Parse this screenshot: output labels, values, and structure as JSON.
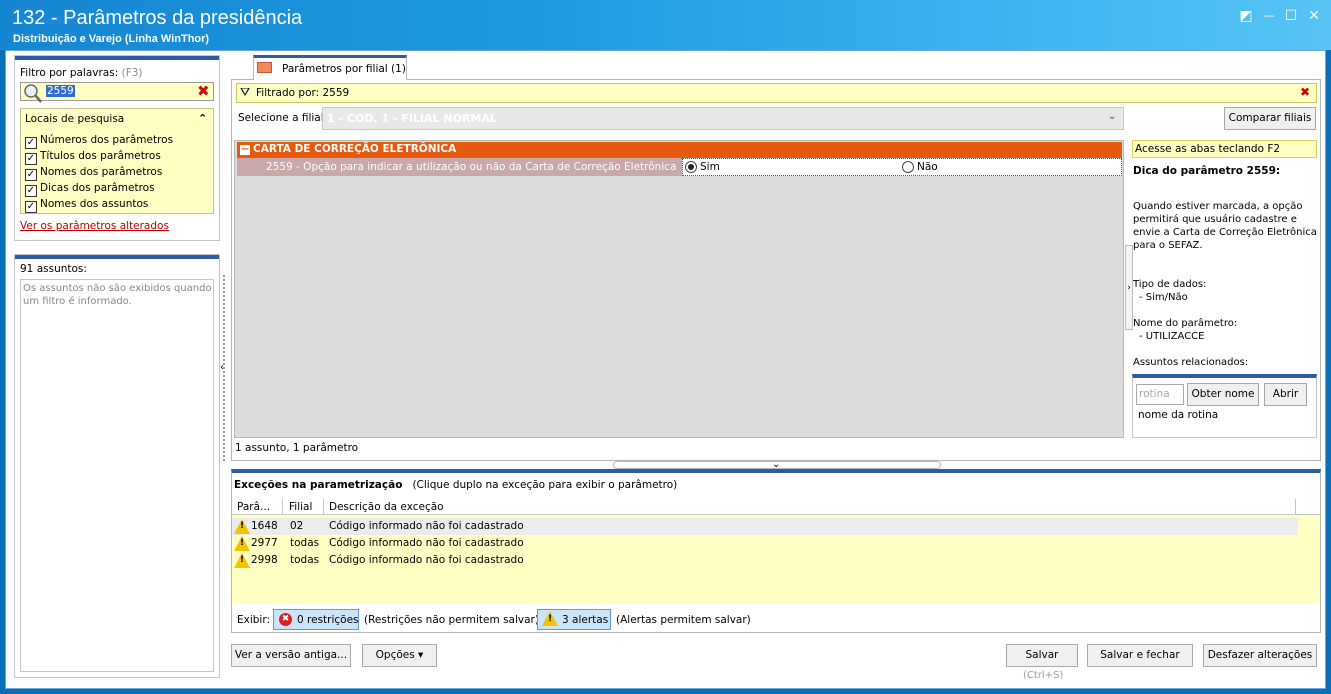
{
  "window": {
    "title": "132 - Parâmetros da presidência",
    "subtitle": "Distribuição e Varejo (Linha WinThor)",
    "restore_glyph": "◩",
    "minimize_glyph": "—",
    "maximize_glyph": "☐",
    "close_glyph": "✕"
  },
  "filter": {
    "label": "Filtro por palavras:",
    "shortcut": "(F3)",
    "value": "2559",
    "clear_glyph": "✖",
    "places_title": "Locais de pesquisa",
    "collapse_glyph": "⌃",
    "places": [
      {
        "label": "Números dos parâmetros",
        "checked": true
      },
      {
        "label": "Títulos dos parâmetros",
        "checked": true
      },
      {
        "label": "Nomes dos parâmetros",
        "checked": true
      },
      {
        "label": "Dicas dos parâmetros",
        "checked": true
      },
      {
        "label": "Nomes dos assuntos",
        "checked": true
      }
    ],
    "check_glyph": "✓",
    "altered_link": "Ver os parâmetros alterados"
  },
  "subjects": {
    "count": "91 assuntos:",
    "message": "Os assuntos não são exibidos quando um filtro é informado."
  },
  "splitter": {
    "collapse_glyph": "‹",
    "expand_down_glyph": "⌄",
    "right_collapse_glyph": "›"
  },
  "tab": {
    "label": "Parâmetros por filial  (1)"
  },
  "filter_bar": {
    "icon": "⛛",
    "text": "Filtrado por: 2559",
    "close_glyph": "✖"
  },
  "branch": {
    "label": "Selecione a filial:",
    "value": "1 - COD. 1 - FILIAL NORMAL",
    "arrow": "⌄",
    "compare_button": "Comparar filiais"
  },
  "grid": {
    "group_toggle": "−",
    "group_title": "CARTA DE CORREÇÃO ELETRÔNICA",
    "param_text": "2559 - Opção para indicar a utilização ou não da Carta de Correção Eletrônica",
    "option_yes": "Sim",
    "option_no": "Não",
    "selected": "Sim",
    "status": "1 assunto, 1 parâmetro"
  },
  "help": {
    "tip": "Acesse as abas teclando F2",
    "title": "Dica do parâmetro 2559:",
    "description": [
      "Quando estiver marcada, a opção",
      "permitirá que usuário cadastre e",
      "envie a Carta de Correção Eletrônica",
      "para o SEFAZ."
    ],
    "data_type_label": "Tipo de dados:",
    "data_type_value": "- Sim/Não",
    "param_name_label": "Nome do parâmetro:",
    "param_name_value": "- UTILIZACCE",
    "related_label": "Assuntos relacionados:",
    "routine_placeholder": "rotina",
    "get_name_button": "Obter nome",
    "open_button": "Abrir",
    "routine_name": "nome da rotina"
  },
  "exceptions": {
    "title": "Exceções na parametrização",
    "hint": "(Clique duplo na exceção para exibir o parâmetro)",
    "columns": [
      "Parâ...",
      "Filial",
      "Descrição da exceção"
    ],
    "rows": [
      {
        "param": "1648",
        "branch": "02",
        "description": "Código informado não foi cadastrado"
      },
      {
        "param": "2977",
        "branch": "todas",
        "description": "Código informado não foi cadastrado"
      },
      {
        "param": "2998",
        "branch": "todas",
        "description": "Código informado não foi cadastrado"
      }
    ],
    "warn_glyph": "!",
    "show_label": "Exibir:",
    "restrictions_icon": "✖",
    "restrictions_button": "0 restrições",
    "restrictions_note": "(Restrições não permitem salvar)",
    "alerts_button": "3 alertas",
    "alerts_note": "(Alertas permitem salvar)"
  },
  "footer": {
    "old_version_button": "Ver a versão antiga...",
    "options_button": "Opções ▾",
    "save_button": "Salvar",
    "save_shortcut": "(Ctrl+S)",
    "save_close_button": "Salvar e fechar",
    "undo_button": "Desfazer alterações"
  },
  "colors": {
    "group_header": "#e55a0e",
    "filter_yellow": "#ffffc4",
    "accent_blue": "#2d5ba8",
    "warning": "#f2c400",
    "error": "#d8201f"
  }
}
